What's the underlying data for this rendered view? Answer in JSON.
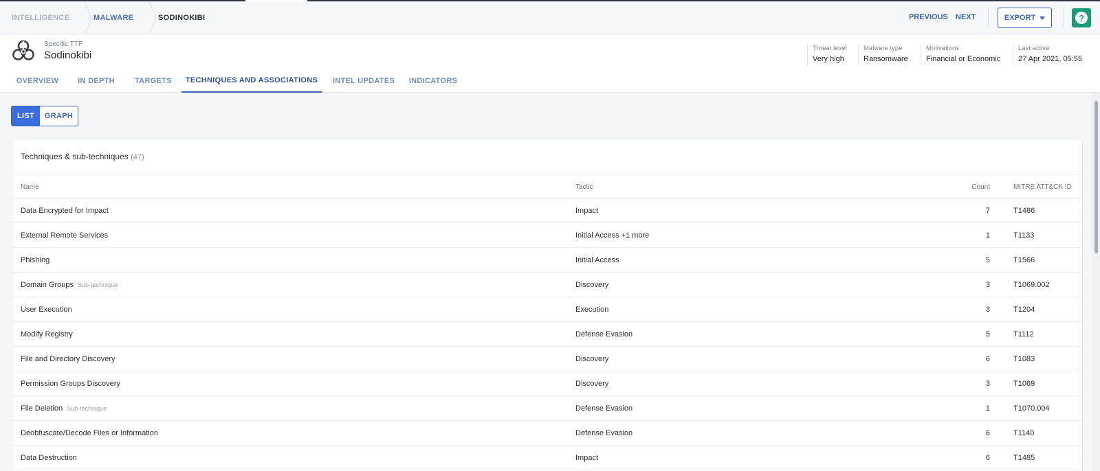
{
  "breadcrumb": {
    "items": [
      "INTELLIGENCE",
      "MALWARE",
      "SODINOKIBI"
    ]
  },
  "nav": {
    "previous": "PREVIOUS",
    "next": "NEXT",
    "export": "EXPORT",
    "help": "?"
  },
  "entity": {
    "kind": "Specific TTP",
    "name": "Sodinokibi",
    "icon": "biohazard-icon"
  },
  "meta": [
    {
      "label": "Threat level",
      "value": "Very high"
    },
    {
      "label": "Malware type",
      "value": "Ransomware"
    },
    {
      "label": "Motivations",
      "value": "Financial or Economic"
    },
    {
      "label": "Last active",
      "value": "27 Apr 2021, 05:55"
    }
  ],
  "tabs": [
    {
      "label": "OVERVIEW",
      "active": false
    },
    {
      "label": "IN DEPTH",
      "active": false
    },
    {
      "label": "TARGETS",
      "active": false
    },
    {
      "label": "TECHNIQUES AND ASSOCIATIONS",
      "active": true
    },
    {
      "label": "INTEL UPDATES",
      "active": false
    },
    {
      "label": "INDICATORS",
      "active": false
    }
  ],
  "view_toggle": {
    "list": "LIST",
    "graph": "GRAPH",
    "selected": "LIST"
  },
  "table": {
    "title": "Techniques & sub-techniques",
    "total": "(47)",
    "columns": {
      "name": "Name",
      "tactic": "Tactic",
      "count": "Count",
      "id": "MITRE ATT&CK ID"
    },
    "rows": [
      {
        "name": "Data Encrypted for Impact",
        "sub": "",
        "tactic": "Impact",
        "count": "7",
        "id": "T1486"
      },
      {
        "name": "External Remote Services",
        "sub": "",
        "tactic": "Initial Access +1 more",
        "count": "1",
        "id": "T1133"
      },
      {
        "name": "Phishing",
        "sub": "",
        "tactic": "Initial Access",
        "count": "5",
        "id": "T1566"
      },
      {
        "name": "Domain Groups",
        "sub": "Sub-technique",
        "tactic": "Discovery",
        "count": "3",
        "id": "T1069.002"
      },
      {
        "name": "User Execution",
        "sub": "",
        "tactic": "Execution",
        "count": "3",
        "id": "T1204"
      },
      {
        "name": "Modify Registry",
        "sub": "",
        "tactic": "Defense Evasion",
        "count": "5",
        "id": "T1112"
      },
      {
        "name": "File and Directory Discovery",
        "sub": "",
        "tactic": "Discovery",
        "count": "6",
        "id": "T1083"
      },
      {
        "name": "Permission Groups Discovery",
        "sub": "",
        "tactic": "Discovery",
        "count": "3",
        "id": "T1069"
      },
      {
        "name": "File Deletion",
        "sub": "Sub-technique",
        "tactic": "Defense Evasion",
        "count": "1",
        "id": "T1070.004"
      },
      {
        "name": "Deobfuscate/Decode Files or Information",
        "sub": "",
        "tactic": "Defense Evasion",
        "count": "6",
        "id": "T1140"
      },
      {
        "name": "Data Destruction",
        "sub": "",
        "tactic": "Impact",
        "count": "6",
        "id": "T1485"
      }
    ]
  },
  "colors": {
    "accent": "#3a63b0",
    "toggle_active": "#3a6ee0",
    "help": "#1a9c7a"
  }
}
